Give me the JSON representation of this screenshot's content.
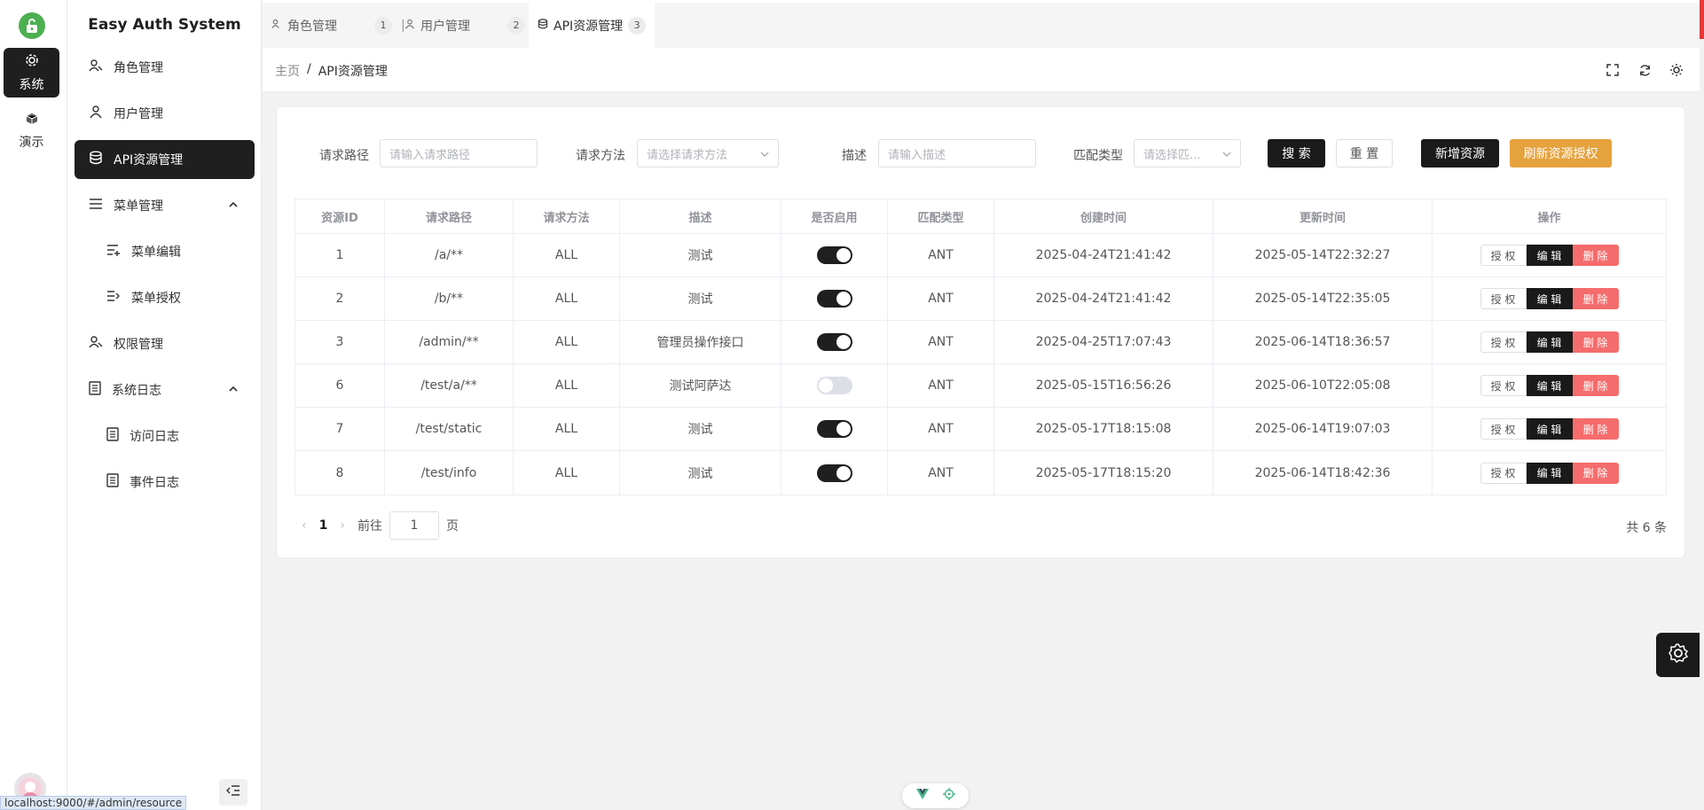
{
  "app": {
    "title": "Easy Auth System"
  },
  "rail": {
    "items": [
      {
        "label": "系统",
        "icon": "gear-icon"
      },
      {
        "label": "演示",
        "icon": "cube-icon"
      }
    ]
  },
  "sidebar": {
    "items": [
      {
        "label": "角色管理",
        "icon": "role-icon"
      },
      {
        "label": "用户管理",
        "icon": "user-icon"
      },
      {
        "label": "API资源管理",
        "icon": "database-icon"
      },
      {
        "label": "菜单管理",
        "icon": "menu-icon"
      },
      {
        "label": "菜单编辑",
        "icon": "menu-edit-icon"
      },
      {
        "label": "菜单授权",
        "icon": "menu-auth-icon"
      },
      {
        "label": "权限管理",
        "icon": "role-icon"
      },
      {
        "label": "系统日志",
        "icon": "document-icon"
      },
      {
        "label": "访问日志",
        "icon": "document-icon"
      },
      {
        "label": "事件日志",
        "icon": "document-icon"
      }
    ]
  },
  "tabs": [
    {
      "label": "角色管理",
      "num": "1"
    },
    {
      "label": "用户管理",
      "num": "2"
    },
    {
      "label": "API资源管理",
      "num": "3"
    }
  ],
  "breadcrumb": {
    "home": "主页",
    "sep": "/",
    "current": "API资源管理"
  },
  "filters": {
    "path_label": "请求路径",
    "path_placeholder": "请输入请求路径",
    "method_label": "请求方法",
    "method_placeholder": "请选择请求方法",
    "desc_label": "描述",
    "desc_placeholder": "请输入描述",
    "match_label": "匹配类型",
    "match_placeholder": "请选择匹...",
    "search_btn": "搜 索",
    "reset_btn": "重 置",
    "add_btn": "新增资源",
    "refresh_btn": "刷新资源授权"
  },
  "table": {
    "headers": [
      "资源ID",
      "请求路径",
      "请求方法",
      "描述",
      "是否启用",
      "匹配类型",
      "创建时间",
      "更新时间",
      "操作"
    ],
    "rows": [
      {
        "id": "1",
        "path": "/a/**",
        "method": "ALL",
        "desc": "测试",
        "enabled": true,
        "match": "ANT",
        "created": "2025-04-24T21:41:42",
        "updated": "2025-05-14T22:32:27"
      },
      {
        "id": "2",
        "path": "/b/**",
        "method": "ALL",
        "desc": "测试",
        "enabled": true,
        "match": "ANT",
        "created": "2025-04-24T21:41:42",
        "updated": "2025-05-14T22:35:05"
      },
      {
        "id": "3",
        "path": "/admin/**",
        "method": "ALL",
        "desc": "管理员操作接口",
        "enabled": true,
        "match": "ANT",
        "created": "2025-04-25T17:07:43",
        "updated": "2025-06-14T18:36:57"
      },
      {
        "id": "6",
        "path": "/test/a/**",
        "method": "ALL",
        "desc": "测试阿萨达",
        "enabled": false,
        "match": "ANT",
        "created": "2025-05-15T16:56:26",
        "updated": "2025-06-10T22:05:08"
      },
      {
        "id": "7",
        "path": "/test/static",
        "method": "ALL",
        "desc": "测试",
        "enabled": true,
        "match": "ANT",
        "created": "2025-05-17T18:15:08",
        "updated": "2025-06-14T19:07:03"
      },
      {
        "id": "8",
        "path": "/test/info",
        "method": "ALL",
        "desc": "测试",
        "enabled": true,
        "match": "ANT",
        "created": "2025-05-17T18:15:20",
        "updated": "2025-06-14T18:42:36"
      }
    ],
    "actions": {
      "grant": "授 权",
      "edit": "编 辑",
      "delete": "删 除"
    }
  },
  "pagination": {
    "prev": "‹",
    "current_page": "1",
    "next": "›",
    "goto_prefix": "前往",
    "goto_value": "1",
    "goto_suffix": "页",
    "total": "共 6 条"
  },
  "status_bar": {
    "url": "localhost:9000/#/admin/resource"
  },
  "colors": {
    "accent": "#1f1f1f",
    "danger": "#f56c6c",
    "warning": "#e6a23c",
    "logo": "#4caf50"
  }
}
